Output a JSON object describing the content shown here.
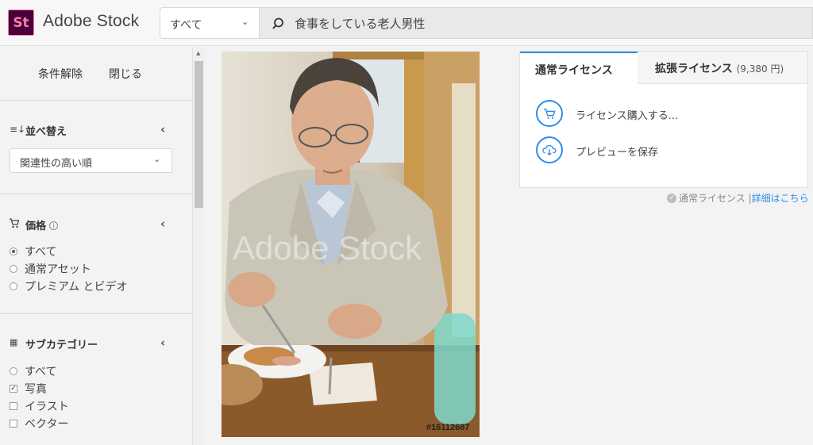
{
  "header": {
    "logo_text": "St",
    "brand": "Adobe Stock",
    "scope_label": "すべて",
    "search_value": "食事をしている老人男性"
  },
  "sidebar": {
    "clear_label": "条件解除",
    "close_label": "閉じる",
    "sort": {
      "title": "並べ替え",
      "selected": "関連性の高い順"
    },
    "price": {
      "title": "価格",
      "options": [
        {
          "label": "すべて",
          "selected": true
        },
        {
          "label": "通常アセット",
          "selected": false
        },
        {
          "label": "プレミアム とビデオ",
          "selected": false
        }
      ]
    },
    "subcategory": {
      "title": "サブカテゴリー",
      "options": [
        {
          "label": "すべて",
          "type": "radio",
          "selected": false
        },
        {
          "label": "写真",
          "type": "checkbox",
          "selected": true
        },
        {
          "label": "イラスト",
          "type": "checkbox",
          "selected": false
        },
        {
          "label": "ベクター",
          "type": "checkbox",
          "selected": false
        }
      ]
    }
  },
  "preview": {
    "watermark": "Adobe Stock",
    "asset_id": "#16112687"
  },
  "license": {
    "tab_standard": "通常ライセンス",
    "tab_extended": "拡張ライセンス",
    "extended_price": "(9,380 円)",
    "buy_label": "ライセンス購入する...",
    "save_label": "プレビューを保存",
    "note_label": "通常ライセンス |",
    "note_link": "詳細はこちら"
  },
  "colors": {
    "accent": "#2d8ceb",
    "logo_bg": "#470137",
    "logo_fg": "#ff7bac"
  }
}
